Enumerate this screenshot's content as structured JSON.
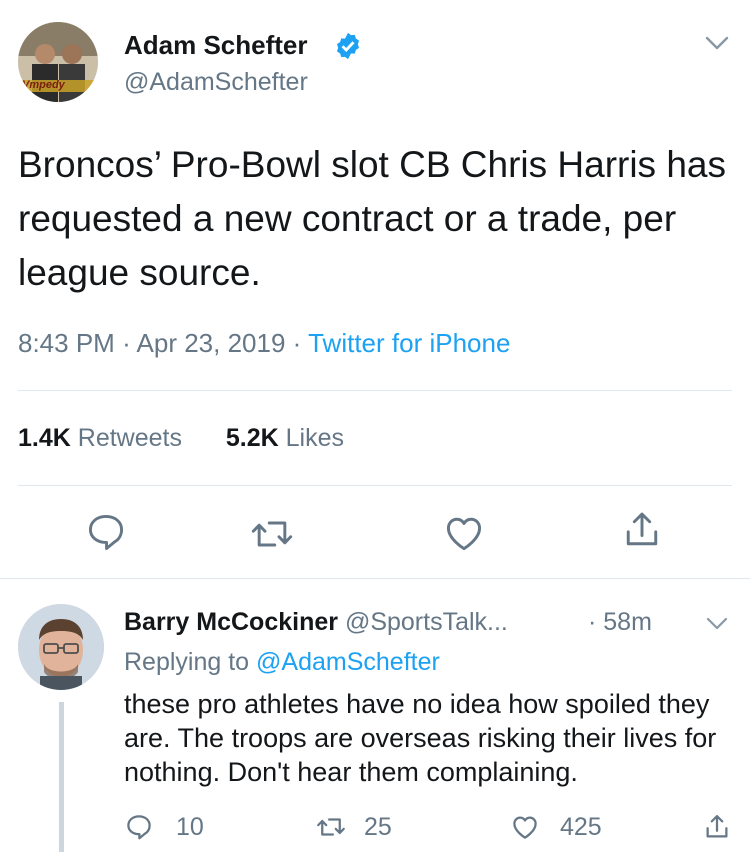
{
  "tweet": {
    "author_name": "Adam Schefter",
    "author_handle": "@AdamSchefter",
    "text": "Broncos’ Pro-Bowl slot CB Chris Harris has requested a new contract or a trade, per league source.",
    "time": "8:43 PM",
    "date": "Apr 23, 2019",
    "separator": "·",
    "source": "Twitter for iPhone",
    "retweets_count": "1.4K",
    "retweets_label": "Retweets",
    "likes_count": "5.2K",
    "likes_label": "Likes",
    "avatar_text": "Vmpedy"
  },
  "reply": {
    "author_name": "Barry McCockiner",
    "author_handle": "@SportsTalk...",
    "separator": "·",
    "time_ago": "58m",
    "replying_prefix": "Replying to",
    "replying_to": "@AdamSchefter",
    "text": "these pro athletes have no idea how spoiled they are. The troops are overseas risking their lives for nothing. Don't hear them complaining.",
    "reply_count": "10",
    "retweet_count": "25",
    "like_count": "425"
  },
  "colors": {
    "accent": "#1da1f2",
    "secondary_text": "#657786",
    "divider": "#e1e8ed",
    "icon": "#657786"
  },
  "icons": [
    "chevron-down-icon",
    "verified-badge-icon",
    "reply-icon",
    "retweet-icon",
    "like-icon",
    "share-icon"
  ]
}
